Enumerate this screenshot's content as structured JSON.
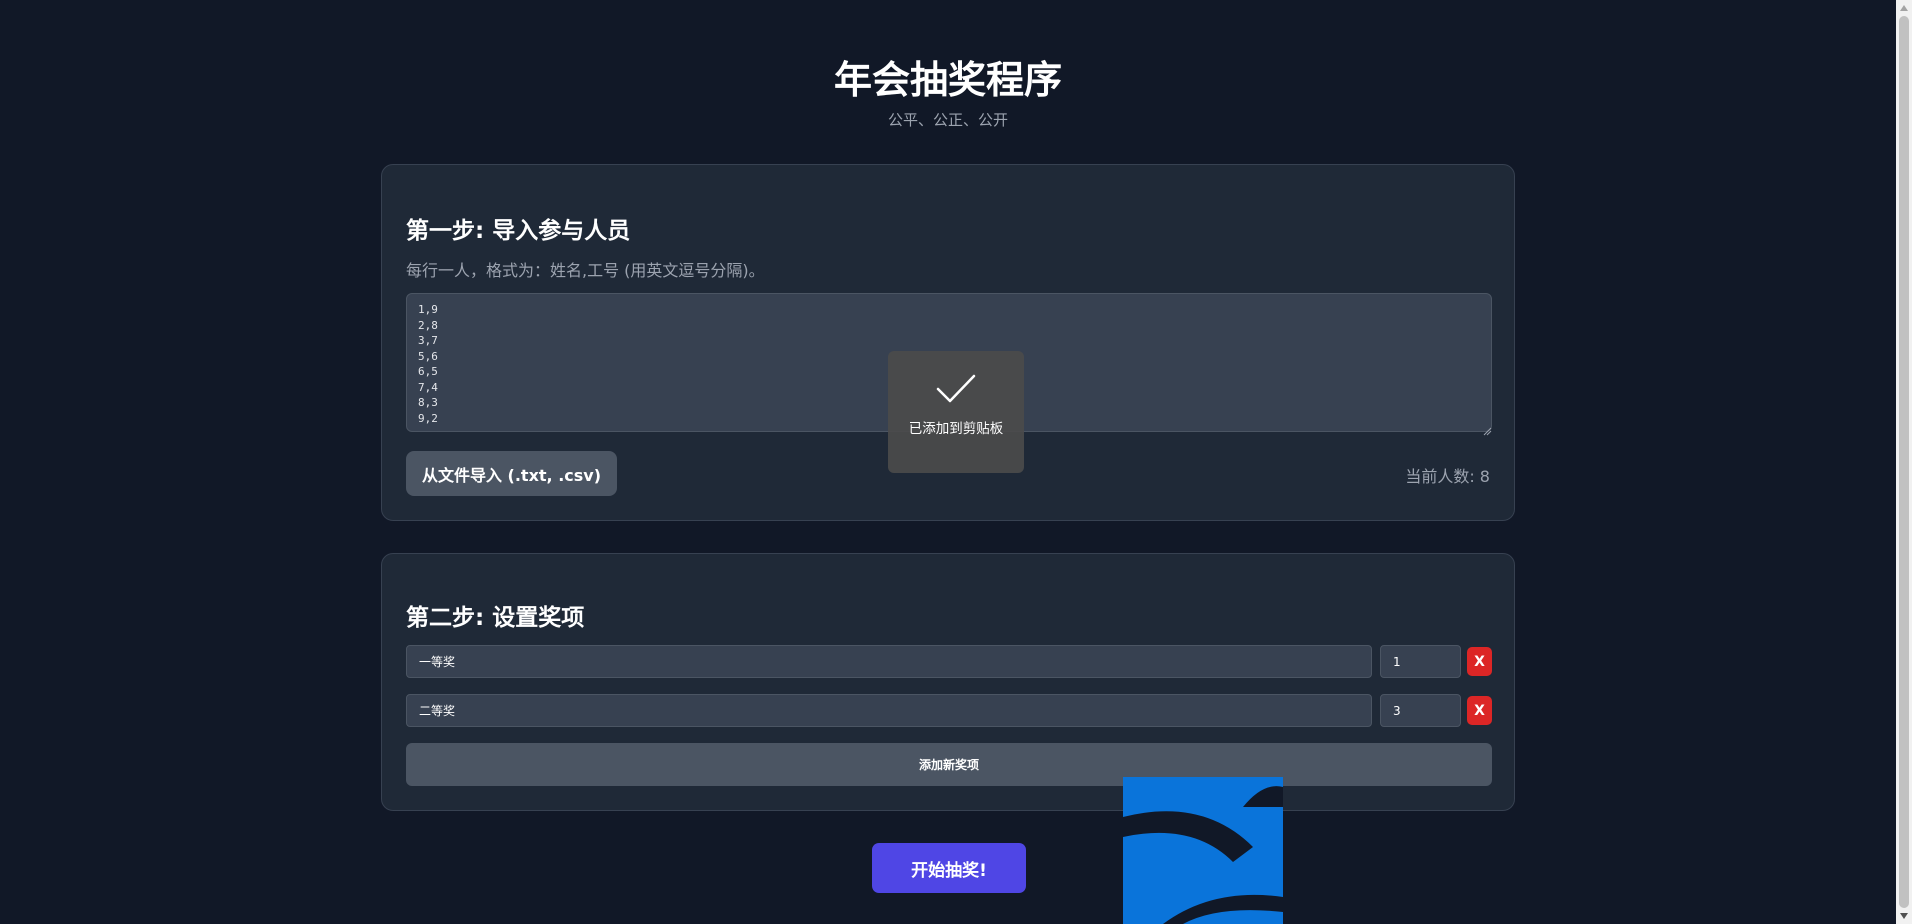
{
  "header": {
    "title": "年会抽奖程序",
    "subtitle": "公平、公正、公开"
  },
  "step1": {
    "heading": "第一步: 导入参与人员",
    "hint": "每行一人，格式为：姓名,工号 (用英文逗号分隔)。",
    "textarea_value": "1,9\n2,8\n3,7\n5,6\n6,5\n7,4\n8,3\n9,2",
    "import_button": "从文件导入 (.txt, .csv)",
    "count_label": "当前人数: 8"
  },
  "toast": {
    "icon": "check-icon",
    "text": "已添加到剪贴板"
  },
  "step2": {
    "heading": "第二步: 设置奖项",
    "prizes": [
      {
        "name": "一等奖",
        "quantity": "1",
        "delete_label": "X"
      },
      {
        "name": "二等奖",
        "quantity": "3",
        "delete_label": "X"
      }
    ],
    "add_button": "添加新奖项"
  },
  "start_button": "开始抽奖!",
  "watermark": {
    "icon": "watermark-logo-icon"
  },
  "colors": {
    "background": "#111827",
    "card": "#1f2937",
    "primary": "#4f46e5",
    "danger": "#dc2626",
    "secondary": "#4b5563",
    "watermark_blue": "#0a74da"
  }
}
